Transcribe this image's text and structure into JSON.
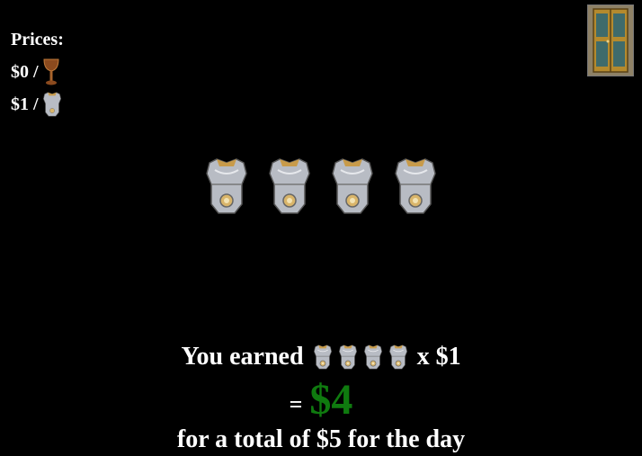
{
  "prices": {
    "heading": "Prices:",
    "items": [
      {
        "label": "$0 /",
        "icon": "goblet-icon"
      },
      {
        "label": "$1 /",
        "icon": "armor-icon"
      }
    ]
  },
  "door": {
    "icon": "door-icon"
  },
  "stage": {
    "item_icon": "armor-icon",
    "count": 4
  },
  "summary": {
    "earned_prefix": "You earned",
    "earned_count": 4,
    "multiplier": "x $1",
    "equals": "=",
    "amount": "$4",
    "total_line": "for a total of $5 for the day",
    "colors": {
      "amount": "#0f7a0f"
    }
  }
}
